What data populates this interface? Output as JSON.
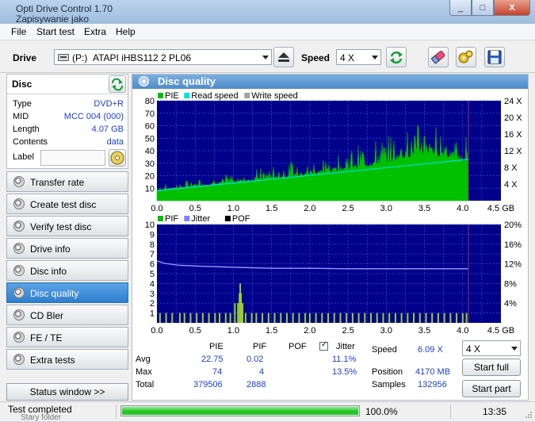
{
  "window": {
    "title": "Opti Drive Control 1.70",
    "subtitle_behind": "Zapisywanie jako",
    "controls": {
      "minimize": "_",
      "maximize": "□",
      "close": "X"
    }
  },
  "menu": [
    "File",
    "Start test",
    "Extra",
    "Help"
  ],
  "toolbar": {
    "drive_label": "Drive",
    "drive_letter": "(P:)",
    "drive_name": "ATAPI iHBS112   2 PL06",
    "speed_label": "Speed",
    "speed_value": "4 X"
  },
  "disc": {
    "title": "Disc",
    "rows": [
      {
        "key": "Type",
        "value": "DVD+R"
      },
      {
        "key": "MID",
        "value": "MCC 004 (000)"
      },
      {
        "key": "Length",
        "value": "4.07 GB"
      },
      {
        "key": "Contents",
        "value": "data"
      }
    ],
    "label_key": "Label"
  },
  "nav": {
    "items": [
      "Transfer rate",
      "Create test disc",
      "Verify test disc",
      "Drive info",
      "Disc info",
      "Disc quality",
      "CD Bler",
      "FE / TE",
      "Extra tests"
    ],
    "active": "Disc quality",
    "status_window": "Status window >>"
  },
  "panel": {
    "title": "Disc quality"
  },
  "chart_data": [
    {
      "type": "area",
      "legend": [
        "PIE",
        "Read speed",
        "Write speed"
      ],
      "legend_colors": [
        "#00c000",
        "#00e0e0",
        "#a0a0a0"
      ],
      "x_ticks": [
        "0.0",
        "0.5",
        "1.0",
        "1.5",
        "2.0",
        "2.5",
        "3.0",
        "3.5",
        "4.0",
        "4.5 GB"
      ],
      "y_left_ticks": [
        "10",
        "20",
        "30",
        "40",
        "50",
        "60",
        "70",
        "80"
      ],
      "y_right_ticks": [
        "4 X",
        "8 X",
        "12 X",
        "16 X",
        "20 X",
        "24 X"
      ],
      "xlim": [
        0,
        4.5
      ],
      "ylim_left": [
        0,
        80
      ],
      "ylim_right": [
        0,
        24
      ],
      "data_end_gb": 4.07,
      "series": [
        {
          "name": "PIE",
          "x": [
            0.0,
            0.5,
            1.0,
            1.5,
            2.0,
            2.5,
            3.0,
            3.2,
            3.4,
            3.6,
            3.8,
            4.0,
            4.07
          ],
          "peaks": [
            12,
            18,
            23,
            28,
            35,
            42,
            52,
            58,
            62,
            62,
            60,
            56,
            52
          ],
          "base": [
            8,
            11,
            14,
            17,
            20,
            24,
            29,
            33,
            36,
            36,
            34,
            30,
            28
          ]
        },
        {
          "name": "Read speed",
          "x": [
            0.0,
            4.07
          ],
          "y": [
            2.4,
            9.9
          ]
        }
      ]
    },
    {
      "type": "bar",
      "legend": [
        "PIF",
        "Jitter",
        "POF"
      ],
      "legend_colors": [
        "#00c000",
        "#8080ff",
        "#000000"
      ],
      "x_ticks": [
        "0.0",
        "0.5",
        "1.0",
        "1.5",
        "2.0",
        "2.5",
        "3.0",
        "3.5",
        "4.0",
        "4.5 GB"
      ],
      "y_left_ticks": [
        "1",
        "2",
        "3",
        "4",
        "5",
        "6",
        "7",
        "8",
        "9",
        "10"
      ],
      "y_right_ticks": [
        "4%",
        "8%",
        "12%",
        "16%",
        "20%"
      ],
      "xlim": [
        0,
        4.5
      ],
      "ylim_left": [
        0,
        10
      ],
      "ylim_right": [
        0,
        20
      ],
      "pif_spikes": [
        [
          0.04,
          1
        ],
        [
          0.12,
          1
        ],
        [
          0.2,
          1
        ],
        [
          0.3,
          1
        ],
        [
          0.36,
          1
        ],
        [
          0.44,
          1
        ],
        [
          0.52,
          1
        ],
        [
          0.6,
          1
        ],
        [
          0.68,
          1
        ],
        [
          0.76,
          1
        ],
        [
          0.82,
          1
        ],
        [
          0.9,
          1
        ],
        [
          0.96,
          1
        ],
        [
          1.02,
          2
        ],
        [
          1.06,
          2
        ],
        [
          1.08,
          3
        ],
        [
          1.09,
          4
        ],
        [
          1.1,
          3
        ],
        [
          1.12,
          2
        ],
        [
          1.16,
          1
        ],
        [
          1.24,
          1
        ],
        [
          1.3,
          1
        ],
        [
          1.38,
          1
        ],
        [
          1.46,
          1
        ],
        [
          1.54,
          1
        ],
        [
          1.62,
          1
        ],
        [
          1.7,
          1
        ],
        [
          1.78,
          1
        ],
        [
          1.86,
          1
        ],
        [
          1.94,
          1
        ],
        [
          2.0,
          1
        ],
        [
          2.08,
          1
        ],
        [
          2.16,
          1
        ],
        [
          2.24,
          1
        ],
        [
          2.32,
          1
        ],
        [
          2.4,
          1
        ],
        [
          2.48,
          1
        ],
        [
          2.56,
          1
        ],
        [
          2.64,
          1
        ],
        [
          2.72,
          1
        ],
        [
          2.8,
          1
        ],
        [
          2.88,
          1
        ],
        [
          2.96,
          1
        ],
        [
          3.04,
          1
        ],
        [
          3.12,
          1
        ],
        [
          3.2,
          1
        ],
        [
          3.28,
          1
        ],
        [
          3.36,
          1
        ],
        [
          3.44,
          1
        ],
        [
          3.52,
          1
        ],
        [
          3.6,
          1
        ],
        [
          3.68,
          1
        ],
        [
          3.76,
          1
        ],
        [
          3.84,
          1
        ],
        [
          3.92,
          1
        ],
        [
          4.0,
          1
        ],
        [
          4.05,
          1
        ]
      ],
      "jitter_line": {
        "x": [
          0.0,
          0.1,
          0.3,
          0.6,
          1.0,
          1.5,
          2.0,
          2.5,
          3.0,
          3.5,
          4.07
        ],
        "y": [
          12.6,
          12.1,
          11.7,
          11.5,
          11.3,
          11.1,
          11.1,
          11.0,
          11.0,
          11.0,
          11.0
        ]
      }
    }
  ],
  "stats": {
    "headers": [
      "PIE",
      "PIF",
      "POF",
      "Jitter"
    ],
    "rows": [
      {
        "label": "Avg",
        "pie": "22.75",
        "pif": "0.02",
        "jitter": "11.1%"
      },
      {
        "label": "Max",
        "pie": "74",
        "pif": "4",
        "jitter": "13.5%"
      },
      {
        "label": "Total",
        "pie": "379506",
        "pif": "2888"
      }
    ],
    "jitter_checked": true
  },
  "info": {
    "speed_label": "Speed",
    "speed_value": "6.09 X",
    "position_label": "Position",
    "position_value": "4170 MB",
    "samples_label": "Samples",
    "samples_value": "132956",
    "speed_select": "4 X",
    "start_full": "Start full",
    "start_part": "Start part"
  },
  "status": {
    "text": "Test completed",
    "progress_pct": 100,
    "progress_text": "100.0%",
    "time": "13:35",
    "behind_text": "Stary folder"
  },
  "colors": {
    "plot_bg": "#00008b",
    "grid": "#2e4fd6",
    "pie": "#00c000",
    "read": "#00e0e0",
    "pif": "#9acd32",
    "jitter": "#9a9aff",
    "end_marker": "#9b2f6e"
  }
}
